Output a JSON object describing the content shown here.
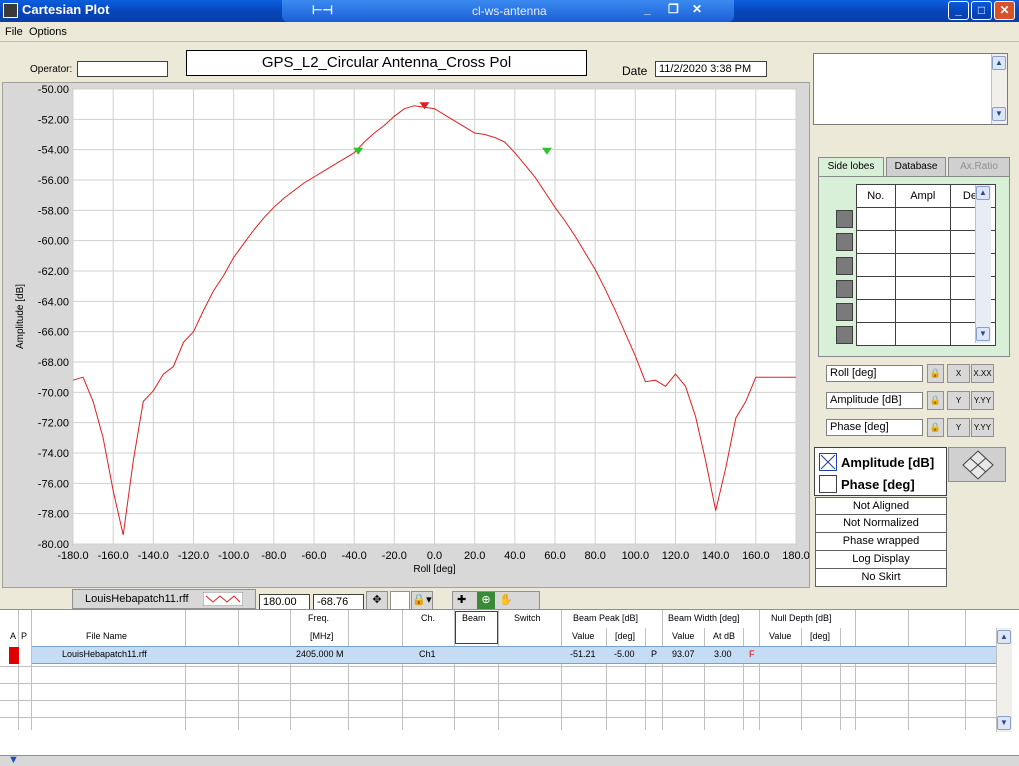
{
  "window": {
    "title": "Cartesian Plot",
    "inner_title": "cl-ws-antenna"
  },
  "menu": [
    "File",
    "Options"
  ],
  "header": {
    "operator_label": "Operator:",
    "operator_value": "",
    "plot_title": "GPS_L2_Circular Antenna_Cross Pol",
    "date_label": "Date",
    "date_value": "11/2/2020 3:38 PM"
  },
  "chart_data": {
    "type": "line",
    "xlabel": "Roll  [deg]",
    "ylabel": "Amplitude [dB]",
    "xlim": [
      -180,
      180
    ],
    "ylim": [
      -80,
      -50
    ],
    "grid": true,
    "x_ticks": [
      "-180.0",
      "-160.0",
      "-140.0",
      "-120.0",
      "-100.0",
      "-80.0",
      "-60.0",
      "-40.0",
      "-20.0",
      "0.0",
      "20.0",
      "40.0",
      "60.0",
      "80.0",
      "100.0",
      "120.0",
      "140.0",
      "160.0",
      "180.0"
    ],
    "y_ticks": [
      "-50.00",
      "-52.00",
      "-54.00",
      "-56.00",
      "-58.00",
      "-60.00",
      "-62.00",
      "-64.00",
      "-66.00",
      "-68.00",
      "-70.00",
      "-72.00",
      "-74.00",
      "-76.00",
      "-78.00",
      "-80.00"
    ],
    "series": [
      {
        "color": "#e02020",
        "x": [
          -180,
          -175,
          -170,
          -165,
          -160,
          -155,
          -150,
          -145,
          -140,
          -135,
          -130,
          -125,
          -120,
          -115,
          -110,
          -105,
          -100,
          -95,
          -90,
          -85,
          -80,
          -75,
          -70,
          -65,
          -60,
          -55,
          -50,
          -45,
          -40,
          -35,
          -30,
          -25,
          -20,
          -15,
          -10,
          -5,
          0,
          5,
          10,
          15,
          20,
          25,
          30,
          35,
          40,
          45,
          50,
          55,
          60,
          65,
          70,
          75,
          80,
          85,
          90,
          95,
          100,
          105,
          110,
          115,
          120,
          125,
          130,
          135,
          140,
          145,
          150,
          155,
          160,
          165,
          170,
          175,
          180
        ],
        "y": [
          -69.2,
          -69.0,
          -70.6,
          -73.0,
          -76.5,
          -79.4,
          -74.5,
          -70.6,
          -69.9,
          -68.8,
          -68.3,
          -66.7,
          -66.0,
          -64.6,
          -63.3,
          -62.3,
          -61.1,
          -60.2,
          -59.3,
          -58.5,
          -57.8,
          -57.2,
          -56.7,
          -56.2,
          -55.8,
          -55.4,
          -55.0,
          -54.6,
          -54.2,
          -53.5,
          -52.9,
          -52.4,
          -51.8,
          -51.3,
          -51.1,
          -51.2,
          -51.3,
          -51.7,
          -52.1,
          -52.5,
          -52.9,
          -53.0,
          -53.2,
          -53.5,
          -54.2,
          -55.0,
          -55.8,
          -56.8,
          -57.8,
          -58.7,
          -59.7,
          -60.8,
          -61.9,
          -63.2,
          -64.6,
          -66.1,
          -67.6,
          -69.3,
          -69.2,
          -69.6,
          -68.8,
          -69.6,
          -71.6,
          -74.5,
          -77.8,
          -75.0,
          -71.7,
          -70.6,
          -69.0,
          -69.0,
          -69.0,
          -69.0,
          -69.0
        ]
      }
    ],
    "markers": [
      {
        "x": -5,
        "y": -51.2,
        "color": "#e02020"
      },
      {
        "x": -38,
        "y": -54.2,
        "color": "#30c030"
      },
      {
        "x": 56,
        "y": -54.2,
        "color": "#30c030"
      }
    ]
  },
  "right_panel": {
    "tabs": [
      "Side lobes",
      "Database",
      "Ax.Ratio"
    ],
    "lobe_headers": [
      "No.",
      "Ampl",
      "Deg"
    ],
    "axis_fields": [
      "Roll  [deg]",
      "Amplitude [dB]",
      "Phase [deg]"
    ],
    "axis_btn_a": [
      "X",
      "Y",
      "Y"
    ],
    "axis_btn_b": [
      "X.XX",
      "Y.YY",
      "Y.YY"
    ],
    "legend": [
      "Amplitude [dB]",
      "Phase [deg]"
    ],
    "status": [
      "Not Aligned",
      "Not Normalized",
      "Phase wrapped",
      "Log Display",
      "No Skirt"
    ]
  },
  "file_strip": {
    "file": "LouisHebapatch11.rff",
    "cursor_x": "180.00",
    "cursor_y": "-68.76"
  },
  "table": {
    "headers": {
      "a": "A",
      "p": "P",
      "file_name": "File Name",
      "freq": "Freq.",
      "freq_unit": "[MHz]",
      "ch": "Ch.",
      "beam": "Beam",
      "switch": "Switch",
      "beam_peak": "Beam Peak [dB]",
      "bp_value": "Value",
      "bp_deg": "[deg]",
      "beam_width": "Beam Width [deg]",
      "bw_value": "Value",
      "bw_at": "At dB",
      "null_depth": "Null Depth [dB]",
      "nd_value": "Value",
      "nd_deg": "[deg]"
    },
    "row": {
      "file": "LouisHebapatch11.rff",
      "freq": "2405.000 M",
      "ch": "Ch1",
      "bp_value": "-51.21",
      "bp_deg": "-5.00",
      "bp_flag": "P",
      "bw_value": "93.07",
      "bw_at": "3.00",
      "bw_flag": "F"
    }
  }
}
